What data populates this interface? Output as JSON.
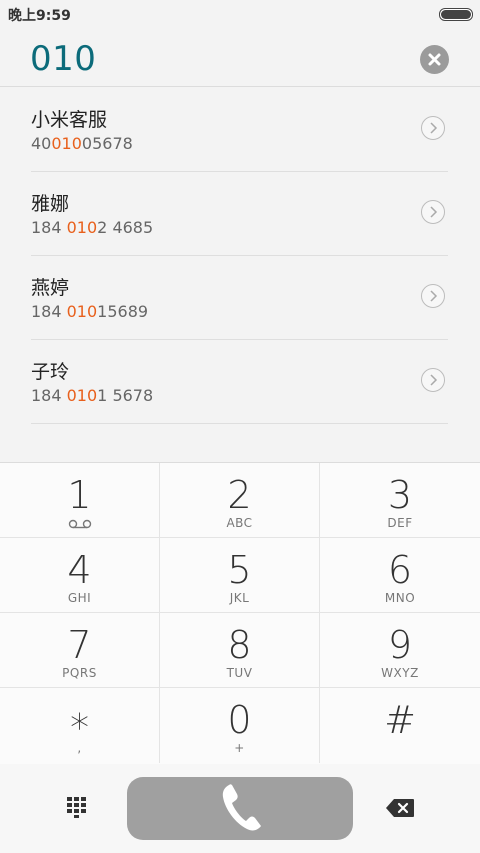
{
  "status_bar": {
    "time": "晚上9:59"
  },
  "dialer": {
    "number": "010"
  },
  "contacts": [
    {
      "name": "小米客服",
      "number_before": "40",
      "number_match": "010",
      "number_after": "05678"
    },
    {
      "name": "雅娜",
      "number_before": "184 ",
      "number_match": "010",
      "number_after": "2 4685"
    },
    {
      "name": "燕婷",
      "number_before": "184 ",
      "number_match": "010",
      "number_after": "15689"
    },
    {
      "name": "子玲",
      "number_before": "184 ",
      "number_match": "010",
      "number_after": "1 5678"
    }
  ],
  "keypad": {
    "keys": [
      {
        "digit": "1",
        "letters": ""
      },
      {
        "digit": "2",
        "letters": "ABC"
      },
      {
        "digit": "3",
        "letters": "DEF"
      },
      {
        "digit": "4",
        "letters": "GHI"
      },
      {
        "digit": "5",
        "letters": "JKL"
      },
      {
        "digit": "6",
        "letters": "MNO"
      },
      {
        "digit": "7",
        "letters": "PQRS"
      },
      {
        "digit": "8",
        "letters": "TUV"
      },
      {
        "digit": "9",
        "letters": "WXYZ"
      },
      {
        "digit": "∗",
        "letters": ","
      },
      {
        "digit": "0",
        "letters": "+"
      },
      {
        "digit": "#",
        "letters": ""
      }
    ]
  },
  "colors": {
    "accent": "#0c6b7a",
    "match_highlight": "#e8601c",
    "call_button": "#a0a0a0"
  },
  "icons": [
    "battery-icon",
    "clear-icon",
    "chevron-right-icon",
    "voicemail-icon",
    "dialpad-icon",
    "phone-icon",
    "backspace-icon"
  ]
}
